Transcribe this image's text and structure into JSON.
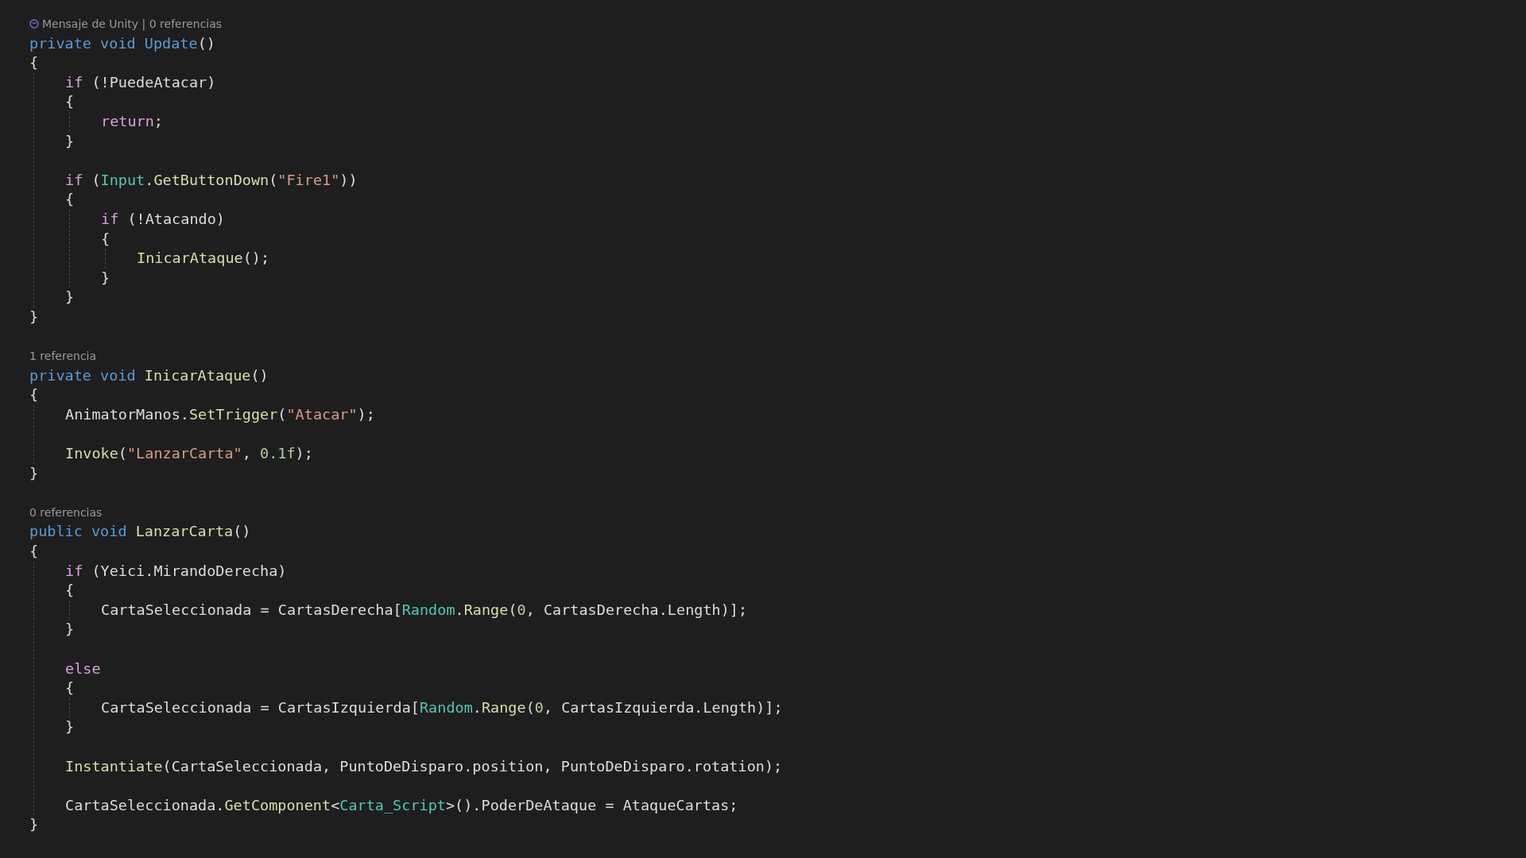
{
  "editor": {
    "lines": [
      {
        "kind": "unity-lens",
        "text": "Mensaje de Unity | 0 referencias"
      },
      {
        "kind": "code",
        "tokens": [
          {
            "text": "private void Update",
            "kind": "keyword"
          },
          {
            "text": "()",
            "kind": "plain"
          }
        ]
      },
      {
        "kind": "code",
        "tokens": [
          {
            "text": "{",
            "kind": "plain"
          }
        ],
        "children": [
          {
            "kind": "code",
            "tokens": [
              {
                "text": "if",
                "kind": "control"
              },
              {
                "text": " (!PuedeAtacar)",
                "kind": "plain"
              }
            ]
          },
          {
            "kind": "code",
            "tokens": [
              {
                "text": "{",
                "kind": "plain"
              }
            ],
            "children": [
              {
                "kind": "code",
                "tokens": [
                  {
                    "text": "return",
                    "kind": "control"
                  },
                  {
                    "text": ";",
                    "kind": "plain"
                  }
                ]
              }
            ]
          },
          {
            "kind": "code",
            "tokens": [
              {
                "text": "}",
                "kind": "plain"
              }
            ]
          },
          {
            "kind": "blank"
          },
          {
            "kind": "code",
            "tokens": [
              {
                "text": "if",
                "kind": "control"
              },
              {
                "text": " (",
                "kind": "plain"
              },
              {
                "text": "Input",
                "kind": "type"
              },
              {
                "text": ".",
                "kind": "plain"
              },
              {
                "text": "GetButtonDown",
                "kind": "method"
              },
              {
                "text": "(",
                "kind": "plain"
              },
              {
                "text": "\"Fire1\"",
                "kind": "string"
              },
              {
                "text": "))",
                "kind": "plain"
              }
            ]
          },
          {
            "kind": "code",
            "tokens": [
              {
                "text": "{",
                "kind": "plain"
              }
            ],
            "children": [
              {
                "kind": "code",
                "tokens": [
                  {
                    "text": "if",
                    "kind": "control"
                  },
                  {
                    "text": " (!Atacando)",
                    "kind": "plain"
                  }
                ]
              },
              {
                "kind": "code",
                "tokens": [
                  {
                    "text": "{",
                    "kind": "plain"
                  }
                ],
                "children": [
                  {
                    "kind": "code",
                    "tokens": [
                      {
                        "text": "InicarAtaque",
                        "kind": "method"
                      },
                      {
                        "text": "();",
                        "kind": "plain"
                      }
                    ]
                  }
                ]
              },
              {
                "kind": "code",
                "tokens": [
                  {
                    "text": "}",
                    "kind": "plain"
                  }
                ]
              }
            ]
          },
          {
            "kind": "code",
            "tokens": [
              {
                "text": "}",
                "kind": "plain"
              }
            ]
          }
        ]
      },
      {
        "kind": "code",
        "tokens": [
          {
            "text": "}",
            "kind": "plain"
          }
        ]
      },
      {
        "kind": "blank"
      },
      {
        "kind": "lens",
        "text": "1 referencia"
      },
      {
        "kind": "code",
        "tokens": [
          {
            "text": "private void ",
            "kind": "keyword"
          },
          {
            "text": "InicarAtaque",
            "kind": "method"
          },
          {
            "text": "()",
            "kind": "plain"
          }
        ]
      },
      {
        "kind": "code",
        "tokens": [
          {
            "text": "{",
            "kind": "plain"
          }
        ],
        "children": [
          {
            "kind": "code",
            "tokens": [
              {
                "text": "AnimatorManos.",
                "kind": "plain"
              },
              {
                "text": "SetTrigger",
                "kind": "method"
              },
              {
                "text": "(",
                "kind": "plain"
              },
              {
                "text": "\"Atacar\"",
                "kind": "string"
              },
              {
                "text": ");",
                "kind": "plain"
              }
            ]
          },
          {
            "kind": "blank"
          },
          {
            "kind": "code",
            "tokens": [
              {
                "text": "Invoke",
                "kind": "method"
              },
              {
                "text": "(",
                "kind": "plain"
              },
              {
                "text": "\"LanzarCarta\"",
                "kind": "string"
              },
              {
                "text": ", ",
                "kind": "plain"
              },
              {
                "text": "0.1f",
                "kind": "number"
              },
              {
                "text": ");",
                "kind": "plain"
              }
            ]
          }
        ]
      },
      {
        "kind": "code",
        "tokens": [
          {
            "text": "}",
            "kind": "plain"
          }
        ]
      },
      {
        "kind": "blank"
      },
      {
        "kind": "lens",
        "text": "0 referencias"
      },
      {
        "kind": "code",
        "tokens": [
          {
            "text": "public void ",
            "kind": "keyword"
          },
          {
            "text": "LanzarCarta",
            "kind": "method"
          },
          {
            "text": "()",
            "kind": "plain"
          }
        ]
      },
      {
        "kind": "code",
        "tokens": [
          {
            "text": "{",
            "kind": "plain"
          }
        ],
        "children": [
          {
            "kind": "code",
            "tokens": [
              {
                "text": "if",
                "kind": "control"
              },
              {
                "text": " (Yeici.MirandoDerecha)",
                "kind": "plain"
              }
            ]
          },
          {
            "kind": "code",
            "tokens": [
              {
                "text": "{",
                "kind": "plain"
              }
            ],
            "children": [
              {
                "kind": "code",
                "tokens": [
                  {
                    "text": "CartaSeleccionada = CartasDerecha[",
                    "kind": "plain"
                  },
                  {
                    "text": "Random",
                    "kind": "type"
                  },
                  {
                    "text": ".",
                    "kind": "plain"
                  },
                  {
                    "text": "Range",
                    "kind": "method"
                  },
                  {
                    "text": "(",
                    "kind": "plain"
                  },
                  {
                    "text": "0",
                    "kind": "number"
                  },
                  {
                    "text": ", CartasDerecha.Length)];",
                    "kind": "plain"
                  }
                ]
              }
            ]
          },
          {
            "kind": "code",
            "tokens": [
              {
                "text": "}",
                "kind": "plain"
              }
            ]
          },
          {
            "kind": "blank"
          },
          {
            "kind": "code",
            "tokens": [
              {
                "text": "else",
                "kind": "control"
              }
            ]
          },
          {
            "kind": "code",
            "tokens": [
              {
                "text": "{",
                "kind": "plain"
              }
            ],
            "children": [
              {
                "kind": "code",
                "tokens": [
                  {
                    "text": "CartaSeleccionada = CartasIzquierda[",
                    "kind": "plain"
                  },
                  {
                    "text": "Random",
                    "kind": "type"
                  },
                  {
                    "text": ".",
                    "kind": "plain"
                  },
                  {
                    "text": "Range",
                    "kind": "method"
                  },
                  {
                    "text": "(",
                    "kind": "plain"
                  },
                  {
                    "text": "0",
                    "kind": "number"
                  },
                  {
                    "text": ", CartasIzquierda.Length)];",
                    "kind": "plain"
                  }
                ]
              }
            ]
          },
          {
            "kind": "code",
            "tokens": [
              {
                "text": "}",
                "kind": "plain"
              }
            ]
          },
          {
            "kind": "blank"
          },
          {
            "kind": "code",
            "tokens": [
              {
                "text": "Instantiate",
                "kind": "method"
              },
              {
                "text": "(CartaSeleccionada, PuntoDeDisparo.position, PuntoDeDisparo.rotation);",
                "kind": "plain"
              }
            ]
          },
          {
            "kind": "blank"
          },
          {
            "kind": "code",
            "tokens": [
              {
                "text": "CartaSeleccionada.",
                "kind": "plain"
              },
              {
                "text": "GetComponent",
                "kind": "method"
              },
              {
                "text": "<",
                "kind": "plain"
              },
              {
                "text": "Carta_Script",
                "kind": "type"
              },
              {
                "text": ">().PoderDeAtaque = AtaqueCartas;",
                "kind": "plain"
              }
            ]
          }
        ]
      },
      {
        "kind": "code",
        "tokens": [
          {
            "text": "}",
            "kind": "plain"
          }
        ]
      }
    ]
  }
}
